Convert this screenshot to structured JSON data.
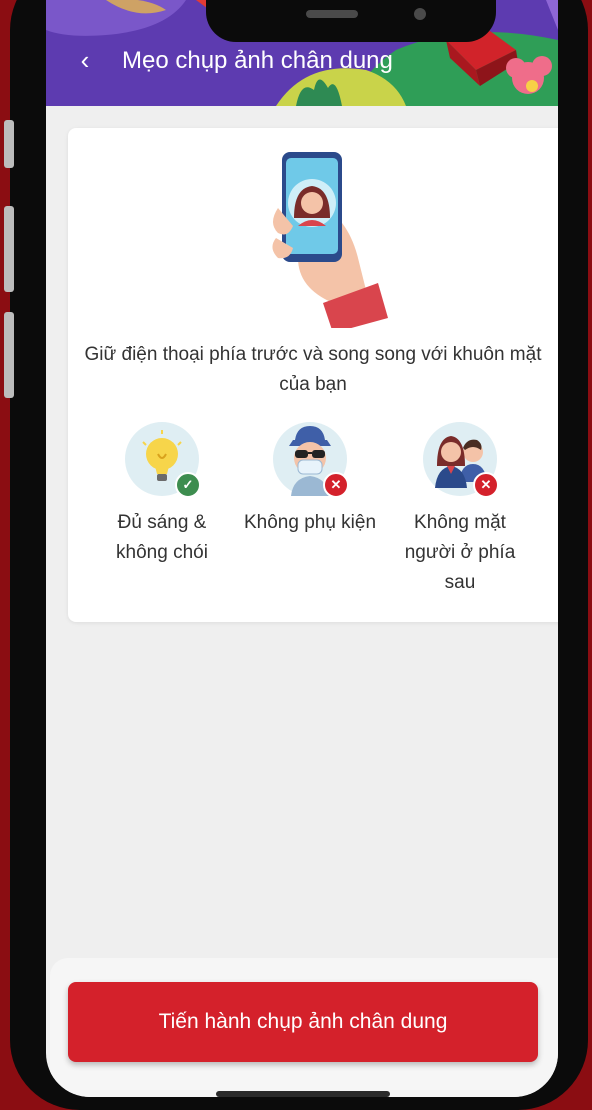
{
  "header": {
    "back_icon": "chevron-left-icon",
    "back_glyph": "‹",
    "title": "Mẹo chụp ảnh chân dung"
  },
  "card": {
    "main_tip": "Giữ điện thoại phía trước và song song với khuôn mặt của bạn",
    "tips": [
      {
        "label": "Đủ sáng & không chói",
        "icon": "light-bulb-icon",
        "status": "ok",
        "badge": "✓"
      },
      {
        "label": "Không phụ kiện",
        "icon": "accessories-person-icon",
        "status": "not-allowed",
        "badge": "✕"
      },
      {
        "label": "Không mặt người ở phía sau",
        "icon": "two-people-icon",
        "status": "not-allowed",
        "badge": "✕"
      }
    ]
  },
  "cta": {
    "label": "Tiến hành chụp ảnh chân dung"
  },
  "colors": {
    "primary": "#d4212b",
    "background": "#8b0d12",
    "ok": "#3d8d4f",
    "error": "#d4212b"
  }
}
